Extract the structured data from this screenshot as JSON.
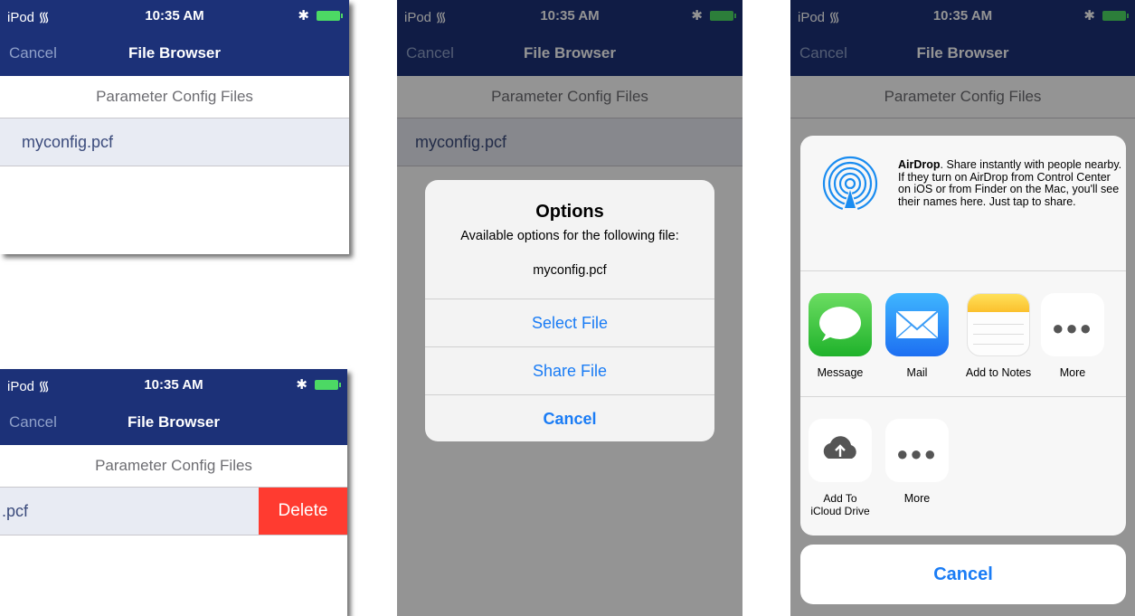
{
  "status": {
    "carrier": "iPod",
    "time": "10:35 AM"
  },
  "nav": {
    "cancel": "Cancel",
    "title": "File Browser"
  },
  "section_header": "Parameter Config Files",
  "file_row": {
    "name": "myconfig.pcf",
    "truncated_name": ".pcf"
  },
  "delete_label": "Delete",
  "alert": {
    "title": "Options",
    "message": "Available options for the following file:",
    "file": "myconfig.pcf",
    "buttons": [
      "Select File",
      "Share File",
      "Cancel"
    ]
  },
  "share": {
    "airdrop_title": "AirDrop",
    "airdrop_text": ". Share instantly with people nearby. If they turn on AirDrop from Control Center on iOS or from Finder on the Mac, you'll see their names here. Just tap to share.",
    "apps": [
      "Message",
      "Mail",
      "Add to Notes",
      "More"
    ],
    "actions": [
      "Add To iCloud Drive",
      "More"
    ],
    "cancel": "Cancel"
  },
  "colors": {
    "nav_bar": "#1c3178",
    "tint": "#1a7cf5",
    "delete": "#ff3b30",
    "row_highlight": "#e8ebf3"
  }
}
